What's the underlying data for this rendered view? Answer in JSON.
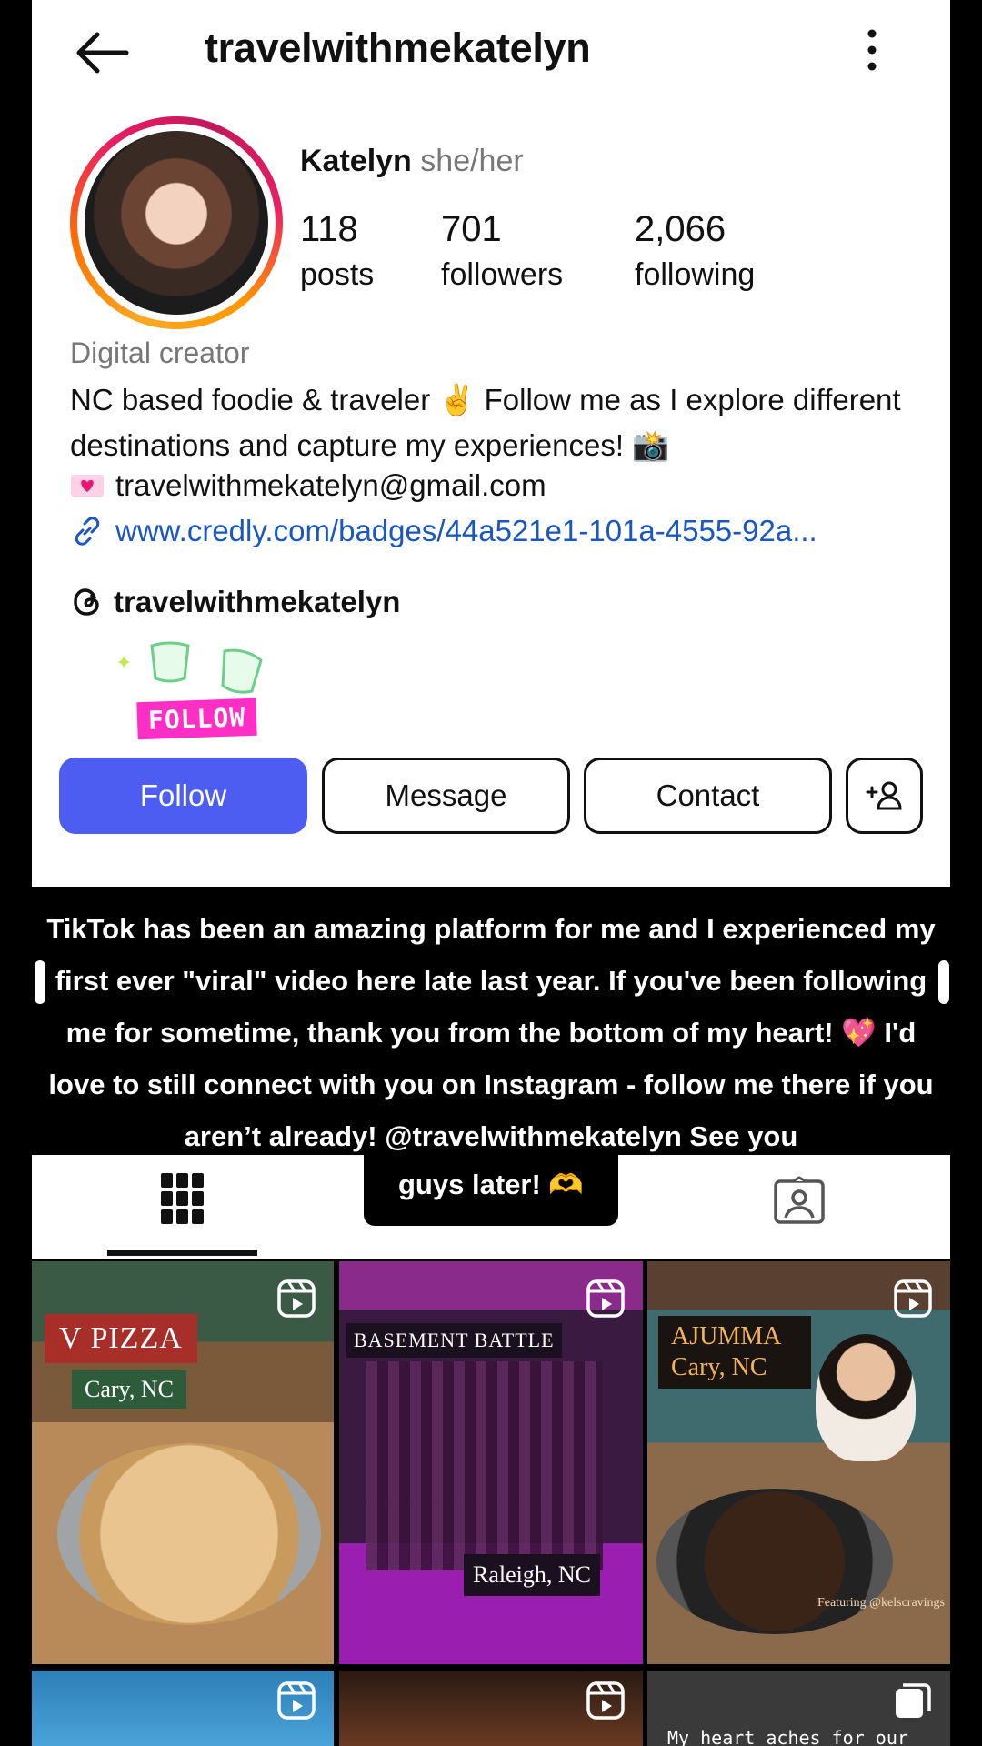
{
  "header": {
    "username": "travelwithmekatelyn"
  },
  "profile": {
    "name": "Katelyn",
    "pronouns": "she/her",
    "stats": [
      {
        "value": "118",
        "label": "posts"
      },
      {
        "value": "701",
        "label": "followers"
      },
      {
        "value": "2,066",
        "label": "following"
      }
    ],
    "category": "Digital creator",
    "bio": "NC based foodie & traveler ✌️ Follow me as I explore different destinations and capture my experiences! 📸",
    "email": "travelwithmekatelyn@gmail.com",
    "link": "www.credly.com/badges/44a521e1-101a-4555-92a...",
    "threads_handle": "travelwithmekatelyn",
    "sticker_text": "FOLLOW"
  },
  "actions": {
    "follow": "Follow",
    "message": "Message",
    "contact": "Contact"
  },
  "caption": {
    "text": "TikTok has been an amazing platform for me and I experienced my first ever \"viral\" video here late last year. If you've been following me for sometime, thank you from the bottom of my heart! 💖 I'd love to still connect with you on Instagram - follow me there if you aren’t already! @travelwithmekatelyn See you",
    "tail": "guys later! 🫶"
  },
  "tiles": [
    {
      "title": "V PIZZA",
      "subtitle": "Cary, NC"
    },
    {
      "title": "BASEMENT BATTLE",
      "subtitle": "Raleigh, NC"
    },
    {
      "title": "AJUMMA",
      "subtitle": "Cary, NC",
      "credit": "Featuring @kelscravings"
    },
    {
      "title": "",
      "subtitle": ""
    },
    {
      "title": "",
      "subtitle": ""
    },
    {
      "title": "My heart aches for our",
      "subtitle": ""
    }
  ],
  "colors": {
    "follow_button": "#4d5df2",
    "link": "#1a56c4",
    "sticker": "#ff2fc6"
  },
  "icons": [
    "back-arrow-icon",
    "more-vertical-icon",
    "link-icon",
    "heart-letter-icon",
    "threads-icon",
    "add-person-icon",
    "grid-icon",
    "tagged-person-icon",
    "reel-icon",
    "carousel-icon"
  ]
}
